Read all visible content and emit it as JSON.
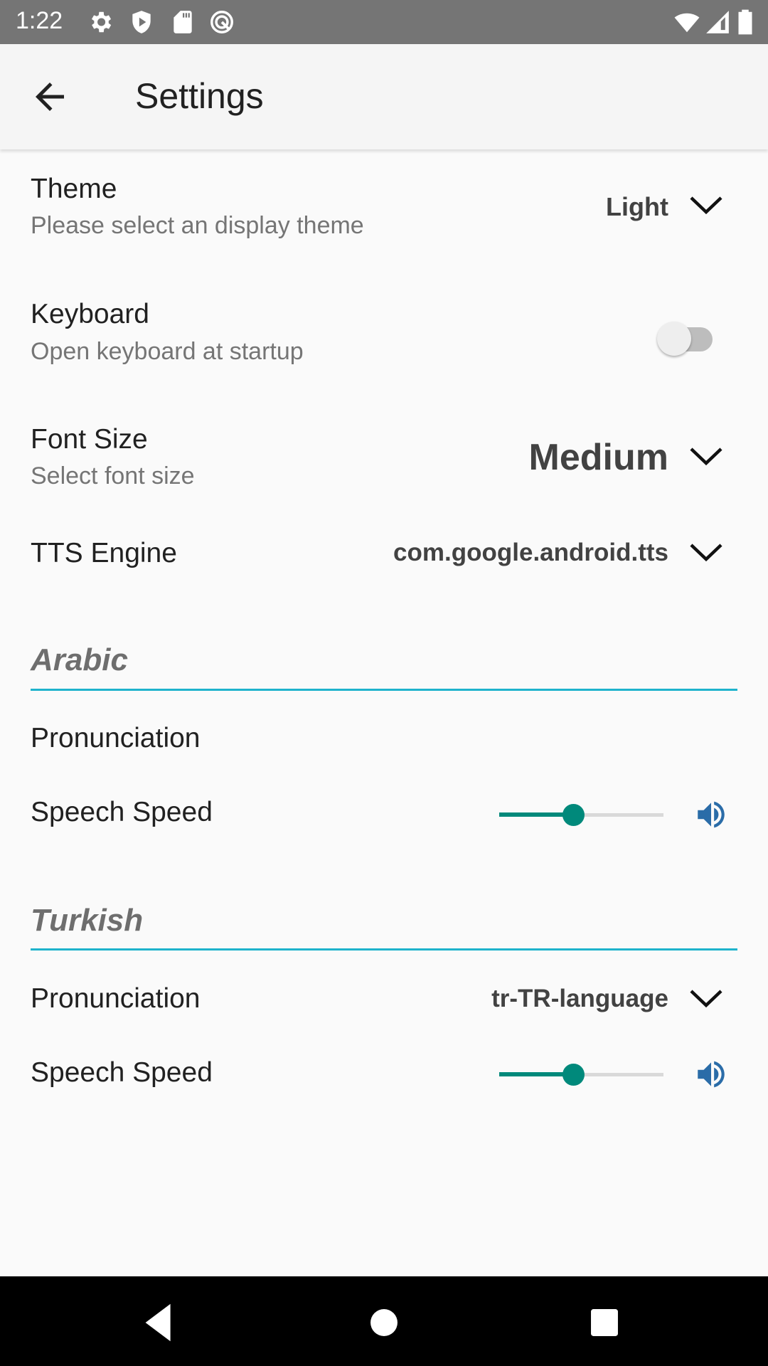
{
  "status_bar": {
    "time": "1:22",
    "left_icons": [
      "settings-icon",
      "shield-play-icon",
      "sd-card-icon",
      "q-logo-icon"
    ],
    "right_icons": [
      "wifi-icon",
      "cell-signal-icon",
      "battery-icon"
    ]
  },
  "app_bar": {
    "back_icon": "arrow-back-icon",
    "title": "Settings"
  },
  "settings": {
    "theme": {
      "title": "Theme",
      "subtitle": "Please select an display theme",
      "value": "Light"
    },
    "keyboard": {
      "title": "Keyboard",
      "subtitle": "Open keyboard at startup",
      "enabled": false
    },
    "font_size": {
      "title": "Font Size",
      "subtitle": "Select font size",
      "value": "Medium"
    },
    "tts_engine": {
      "title": "TTS Engine",
      "value": "com.google.android.tts"
    }
  },
  "sections": {
    "arabic": {
      "header": "Arabic",
      "pronunciation_label": "Pronunciation",
      "speech_speed_label": "Speech Speed",
      "speech_speed_fraction": 0.45
    },
    "turkish": {
      "header": "Turkish",
      "pronunciation_label": "Pronunciation",
      "pronunciation_value": "tr-TR-language",
      "speech_speed_label": "Speech Speed",
      "speech_speed_fraction": 0.45
    }
  },
  "colors": {
    "accent": "#00897b",
    "divider": "#1eb3cc",
    "speaker": "#2a6ca8"
  },
  "nav_bar": {
    "buttons": [
      "nav-back-icon",
      "nav-home-icon",
      "nav-recents-icon"
    ]
  }
}
